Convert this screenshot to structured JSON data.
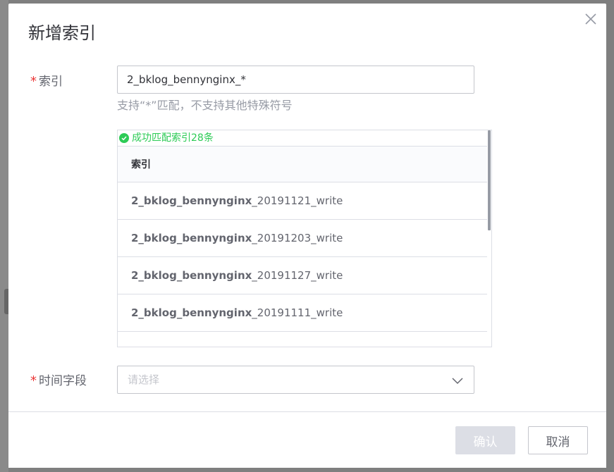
{
  "dialog": {
    "title": "新增索引",
    "close_icon": "close-icon"
  },
  "form": {
    "index_label": "索引",
    "index_value": "2_bklog_bennynginx_*",
    "index_hint": "支持“*”匹配，不支持其他特殊符号",
    "match_status": "成功匹配索引28条",
    "match_icon": "check-circle-icon",
    "table_header": "索引",
    "rows": [
      {
        "prefix": "2_bklog_bennynginx",
        "suffix": "_20191121_write"
      },
      {
        "prefix": "2_bklog_bennynginx",
        "suffix": "_20191203_write"
      },
      {
        "prefix": "2_bklog_bennynginx",
        "suffix": "_20191127_write"
      },
      {
        "prefix": "2_bklog_bennynginx",
        "suffix": "_20191111_write"
      }
    ],
    "time_label": "时间字段",
    "time_placeholder": "请选择",
    "required_mark": "*"
  },
  "footer": {
    "confirm_label": "确认",
    "cancel_label": "取消"
  },
  "colors": {
    "required": "#ea3636",
    "success": "#2dcb56",
    "disabled_button": "#dcdee5"
  }
}
